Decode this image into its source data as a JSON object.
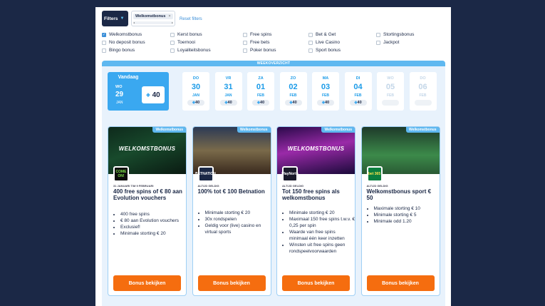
{
  "filters": {
    "button_label": "Filters",
    "active_chip": "Welkomstbonus",
    "reset_label": "Reset filters",
    "options": [
      {
        "label": "Welkomstbonus",
        "checked": true
      },
      {
        "label": "Kerst bonus",
        "checked": false
      },
      {
        "label": "Free spins",
        "checked": false
      },
      {
        "label": "Bet & Get",
        "checked": false
      },
      {
        "label": "Stortingsbonus",
        "checked": false
      },
      {
        "label": "No deposit bonus",
        "checked": false
      },
      {
        "label": "Toernooi",
        "checked": false
      },
      {
        "label": "Free bets",
        "checked": false
      },
      {
        "label": "Live Casino",
        "checked": false
      },
      {
        "label": "Jackpot",
        "checked": false
      },
      {
        "label": "Bingo bonus",
        "checked": false
      },
      {
        "label": "Loyaliteitsbonus",
        "checked": false
      },
      {
        "label": "Poker bonus",
        "checked": false
      },
      {
        "label": "Sport bonus",
        "checked": false
      }
    ]
  },
  "week": {
    "header": "WEEKOVERZICHT",
    "today": {
      "label": "Vandaag",
      "dow": "WO",
      "day": "29",
      "month": "JAN",
      "count": "40"
    },
    "days": [
      {
        "dow": "DO",
        "day": "30",
        "month": "JAN",
        "count": "40",
        "dim": false
      },
      {
        "dow": "VR",
        "day": "31",
        "month": "JAN",
        "count": "40",
        "dim": false
      },
      {
        "dow": "ZA",
        "day": "01",
        "month": "FEB",
        "count": "40",
        "dim": false
      },
      {
        "dow": "ZO",
        "day": "02",
        "month": "FEB",
        "count": "40",
        "dim": false
      },
      {
        "dow": "MA",
        "day": "03",
        "month": "FEB",
        "count": "40",
        "dim": false
      },
      {
        "dow": "DI",
        "day": "04",
        "month": "FEB",
        "count": "40",
        "dim": false
      },
      {
        "dow": "WO",
        "day": "05",
        "month": "FEB",
        "count": "",
        "dim": true
      },
      {
        "dow": "DO",
        "day": "06",
        "month": "FEB",
        "count": "",
        "dim": true
      }
    ]
  },
  "offers": [
    {
      "badge": "Welkomstbonus",
      "logo_text": "COME ON!",
      "logo_color": "#0c0c0c",
      "logo_fg": "#7ee04a",
      "meta": "31 JANUARI T/M 9 FEBRUARI",
      "title": "400 free spins of € 80 aan Evolution vouchers",
      "bullets": [
        "400 free spins",
        "€ 80 aan Evolution vouchers",
        "Exclusief!",
        "Minimale storting € 20"
      ],
      "cta": "Bonus bekijken",
      "image_text": "WELKOMSTBONUS"
    },
    {
      "badge": "Welkomstbonus",
      "logo_text": "BETNATION",
      "logo_color": "#1b2846",
      "logo_fg": "#ffffff",
      "meta": "ALTIJD GELDIG",
      "title": "100% tot € 100 Betnation",
      "bullets": [
        "Minimale storting € 20",
        "30x rondspelen",
        "Geldig voor (live) casino en virtual sports"
      ],
      "cta": "Bonus bekijken",
      "image_text": ""
    },
    {
      "badge": "Welkomstbonus",
      "logo_text": "PlayNorth",
      "logo_color": "#1a1a2a",
      "logo_fg": "#ffffff",
      "meta": "ALTIJD GELDIG",
      "title": "Tot 150 free spins als welkomstbonus",
      "bullets": [
        "Minimale storting € 20",
        "Maximaal 150 free spins t.w.v. € 0,25 per spin",
        "Waarde van free spins minimaal één keer inzetten",
        "Winsten uit free spins geen rondspeelvoorwaarden"
      ],
      "cta": "Bonus bekijken",
      "image_text": "WELKOMSTBONUS"
    },
    {
      "badge": "Welkomstbonus",
      "logo_text": "bet 365",
      "logo_color": "#0b7f3f",
      "logo_fg": "#ffe44d",
      "meta": "ALTIJD GELDIG",
      "title": "Welkomstbonus sport € 50",
      "bullets": [
        "Maximale storting € 10",
        "Minimale storting € 5",
        "Minimale odd 1.20"
      ],
      "cta": "Bonus bekijken",
      "image_text": ""
    }
  ]
}
